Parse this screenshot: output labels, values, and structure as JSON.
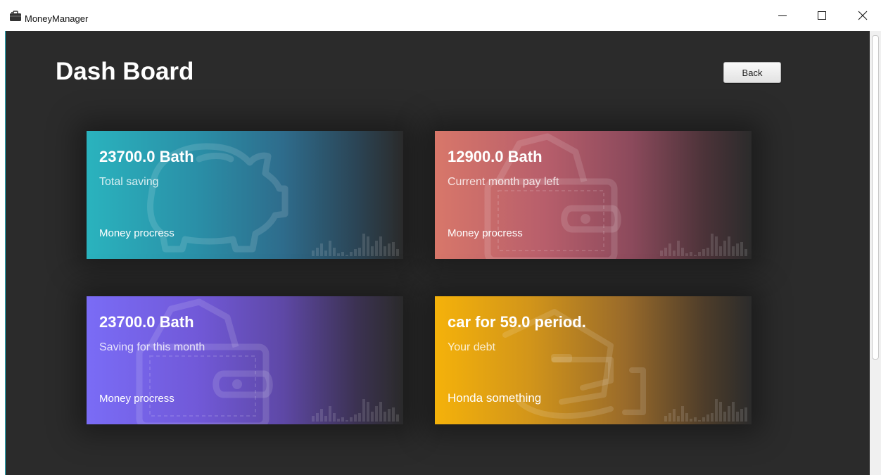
{
  "window": {
    "title": "MoneyManager",
    "controls": {
      "minimize_icon": "minimize-icon",
      "maximize_icon": "maximize-icon",
      "close_icon": "close-icon"
    }
  },
  "page": {
    "title": "Dash Board",
    "back_label": "Back"
  },
  "cards": [
    {
      "value": "23700.0 Bath",
      "label": "Total saving",
      "footer": "Money procress",
      "icon": "piggy-bank-icon",
      "accent": "#2ab3be"
    },
    {
      "value": "12900.0 Bath",
      "label": "Current month pay left",
      "footer": "Money procress",
      "icon": "wallet-icon",
      "accent": "#d8776a"
    },
    {
      "value": "23700.0 Bath",
      "label": "Saving for this month",
      "footer": "Money procress",
      "icon": "wallet-icon",
      "accent": "#7a6cf6"
    },
    {
      "value": "car for 59.0 period.",
      "label": "Your debt",
      "footer": "Honda something",
      "icon": "hand-card-icon",
      "accent": "#f5b20a"
    }
  ],
  "colors": {
    "background": "#2b2b2b",
    "text": "#ffffff"
  }
}
